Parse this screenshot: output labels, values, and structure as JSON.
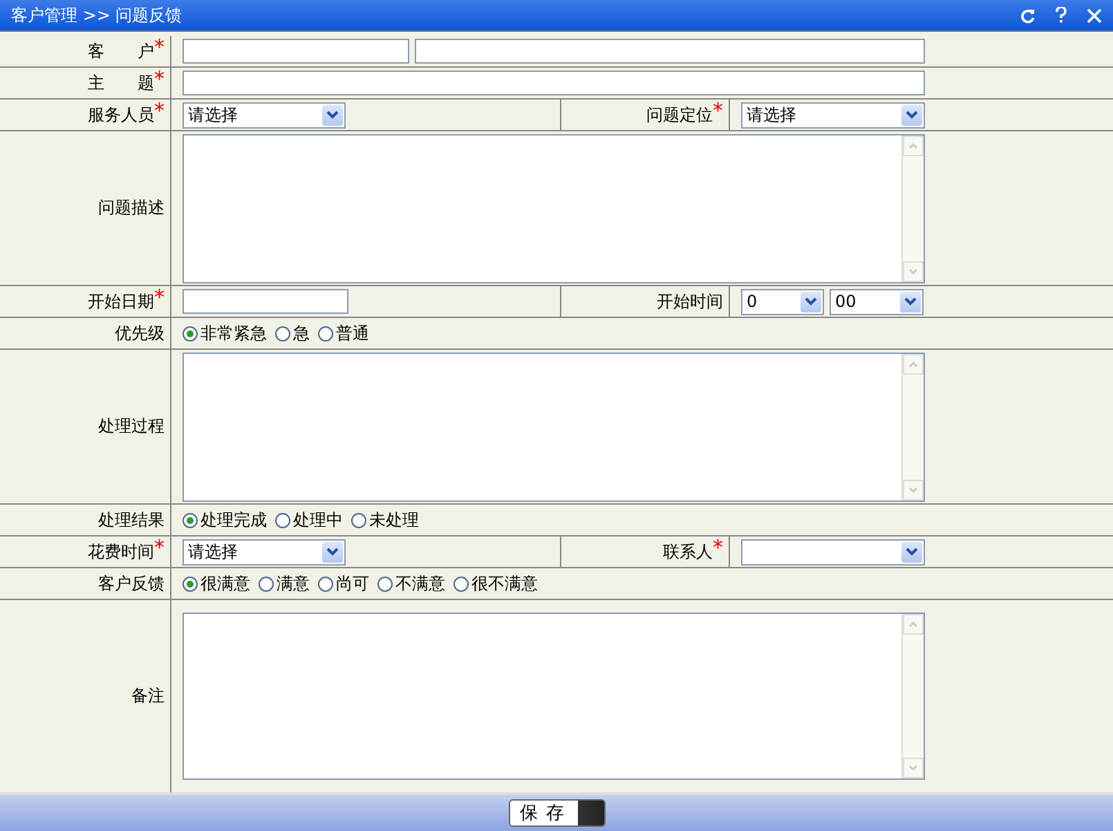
{
  "title": "客户管理 >> 问题反馈",
  "rows": [
    {
      "cells": [
        {
          "label": "客　　户",
          "required_mark": "*",
          "kind": "input2"
        }
      ]
    },
    {
      "cells": [
        {
          "label": "主　　题",
          "required_mark": "*",
          "kind": "input"
        }
      ]
    },
    {
      "cells": [
        {
          "label": "服务人员",
          "required_mark": "*",
          "kind": "select",
          "value": "请选择"
        },
        {
          "label": "问题定位",
          "required_mark": "*",
          "kind": "select",
          "value": "请选择"
        }
      ]
    },
    {
      "cells": [
        {
          "label": "问题描述",
          "kind": "textarea"
        }
      ]
    },
    {
      "cells": [
        {
          "label": "开始日期",
          "required_mark": "*",
          "kind": "date"
        },
        {
          "label": "开始时间",
          "kind": "time",
          "values": [
            "0",
            "00"
          ]
        }
      ]
    },
    {
      "cells": [
        {
          "label": "优先级",
          "kind": "radios",
          "options": [
            {
              "label": "非常紧急",
              "selected": true
            },
            {
              "label": "急",
              "selected": false
            },
            {
              "label": "普通",
              "selected": false
            }
          ]
        }
      ]
    },
    {
      "cells": [
        {
          "label": "处理过程",
          "kind": "textarea"
        }
      ]
    },
    {
      "cells": [
        {
          "label": "处理结果",
          "kind": "radios",
          "options": [
            {
              "label": "处理完成",
              "selected": true
            },
            {
              "label": "处理中",
              "selected": false
            },
            {
              "label": "未处理",
              "selected": false
            }
          ]
        }
      ]
    },
    {
      "cells": [
        {
          "label": "花费时间",
          "required_mark": "*",
          "kind": "select",
          "value": "请选择"
        },
        {
          "label": "联系人",
          "required_mark": "*",
          "kind": "select"
        }
      ]
    },
    {
      "cells": [
        {
          "label": "客户反馈",
          "kind": "radios",
          "options": [
            {
              "label": "很满意",
              "selected": true
            },
            {
              "label": "满意",
              "selected": false
            },
            {
              "label": "尚可",
              "selected": false
            },
            {
              "label": "不满意",
              "selected": false
            },
            {
              "label": "很不满意",
              "selected": false
            }
          ]
        }
      ]
    },
    {
      "cells": [
        {
          "label": "备注",
          "kind": "textarea"
        }
      ]
    }
  ],
  "save_button": "保 存"
}
